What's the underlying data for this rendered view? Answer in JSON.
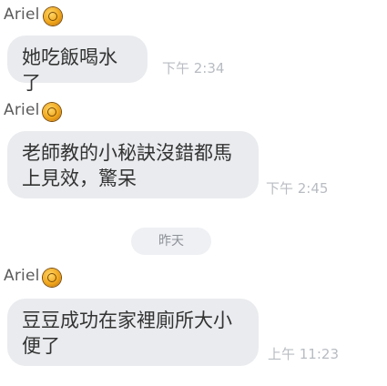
{
  "messages": [
    {
      "sender": "Ariel",
      "avatar_icon": "honey-jar-icon",
      "text": "她吃飯喝水了",
      "time": "下午 2:34"
    },
    {
      "sender": "Ariel",
      "avatar_icon": "honey-jar-icon",
      "text": "老師教的小秘訣沒錯都馬\n上見效，驚呆",
      "time": "下午 2:45"
    },
    {
      "sender": "Ariel",
      "avatar_icon": "honey-jar-icon",
      "text": "豆豆成功在家裡廁所大小\n便了",
      "time": "上午 11:23"
    }
  ],
  "date_divider": "昨天",
  "colors": {
    "bubble_bg": "#e9ebee",
    "timestamp": "#b8bcc2",
    "sender_name": "#5b5b5b",
    "avatar": "#f0a61c"
  }
}
